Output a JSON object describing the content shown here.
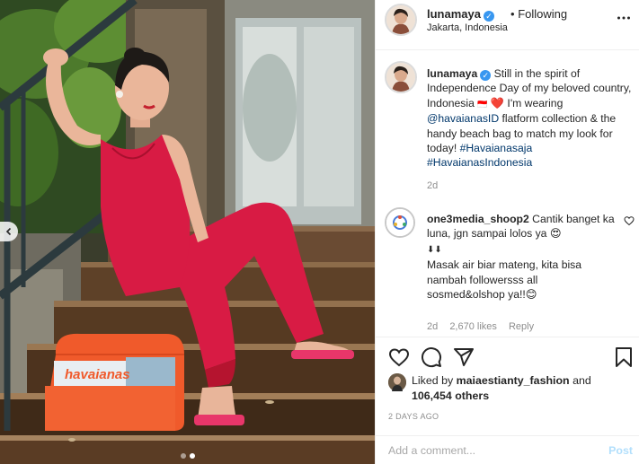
{
  "header": {
    "username": "lunamaya",
    "separator": "•",
    "follow_label": "Following",
    "location": "Jakarta, Indonesia",
    "more_icon": "more-horizontal-icon"
  },
  "caption": {
    "username": "lunamaya",
    "text_1": " Still in the spirit of Independence Day of my beloved country, Indonesia ",
    "flag_emoji": "🇮🇩",
    "heart_emoji": "❤️",
    "text_2": " I'm wearing ",
    "mention": "@havaianasID",
    "text_3": " flatform collection & the handy beach bag to match my look for today! ",
    "hashtag_1": "#Havaianasaja",
    "hashtag_2": "#HavaianasIndonesia",
    "age": "2d"
  },
  "comment": {
    "username": "one3media_shoop2",
    "text_1": " Cantik banget ka luna, jgn sampai lolos ya ",
    "emoji_1": "😍",
    "arrows": "⬇⬇",
    "text_2": "Masak air biar mateng, kita bisa nambah followersss all sosmed&olshop ya!!",
    "emoji_2": "😊",
    "age": "2d",
    "likes": "2,670 likes",
    "reply_label": "Reply"
  },
  "actions": {
    "icons": [
      "heart-icon",
      "comment-icon",
      "share-icon",
      "bookmark-icon"
    ]
  },
  "likes": {
    "prefix": "Liked by ",
    "user": "maiaestianty_fashion",
    "and_label": " and",
    "count": "106,454 others"
  },
  "date": "2 DAYS AGO",
  "add_comment": {
    "placeholder": "Add a comment...",
    "post_label": "Post"
  },
  "carousel": {
    "current_slide": 2,
    "total_slides": 2
  },
  "colors": {
    "dress": "#d81b44",
    "bag": "#f05a2b",
    "verified": "#3897f0",
    "link": "#00376b",
    "post_button_disabled": "#b2dffc"
  }
}
